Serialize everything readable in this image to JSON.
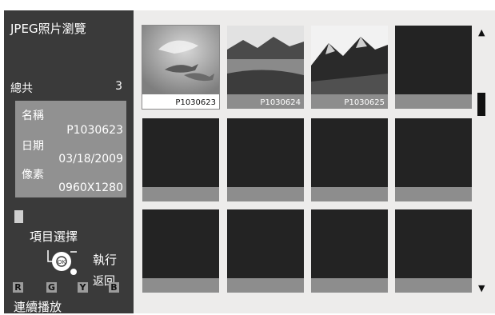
{
  "sidebar": {
    "title": "JPEG照片瀏覽",
    "total_label": "總共",
    "total_count": "3",
    "info": {
      "name_label": "名稱",
      "name_value": "P1030623",
      "date_label": "日期",
      "date_value": "03/18/2009",
      "pixels_label": "像素",
      "pixels_value": "0960X1280"
    },
    "item_select": "項目選擇",
    "execute": "執行",
    "back": "返回",
    "color_keys": [
      "R",
      "G",
      "Y",
      "B"
    ],
    "continuous_play": "連續播放"
  },
  "grid": {
    "tiles": [
      {
        "caption": "P1030623",
        "icon": "dolphin-photo",
        "selected": true
      },
      {
        "caption": "P1030624",
        "icon": "landscape-photo",
        "selected": false
      },
      {
        "caption": "P1030625",
        "icon": "mountain-photo",
        "selected": false
      },
      {
        "caption": "",
        "icon": "",
        "selected": false
      }
    ]
  },
  "scrollbar": {
    "up_icon": "▲",
    "down_icon": "▼"
  }
}
